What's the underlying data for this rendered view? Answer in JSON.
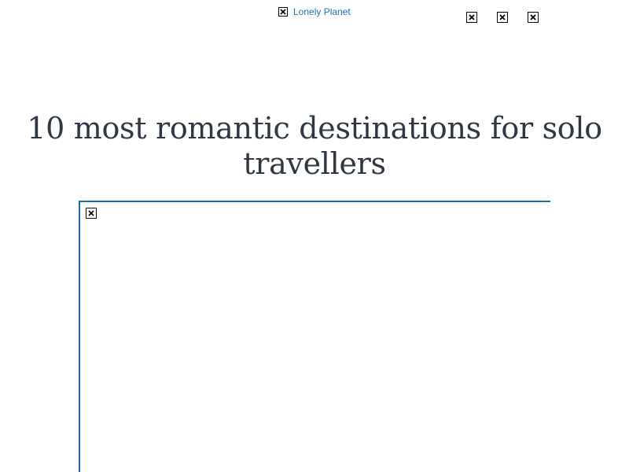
{
  "header": {
    "logo_alt": "Lonely Planet",
    "icons": [
      {
        "name": "broken-image-icon"
      },
      {
        "name": "broken-image-icon"
      },
      {
        "name": "broken-image-icon"
      }
    ]
  },
  "article": {
    "title": "10 most romantic destinations for solo travellers"
  },
  "colors": {
    "link": "#1a6fb4",
    "title": "#2e3742",
    "frame_border": "#1a6fb4"
  }
}
